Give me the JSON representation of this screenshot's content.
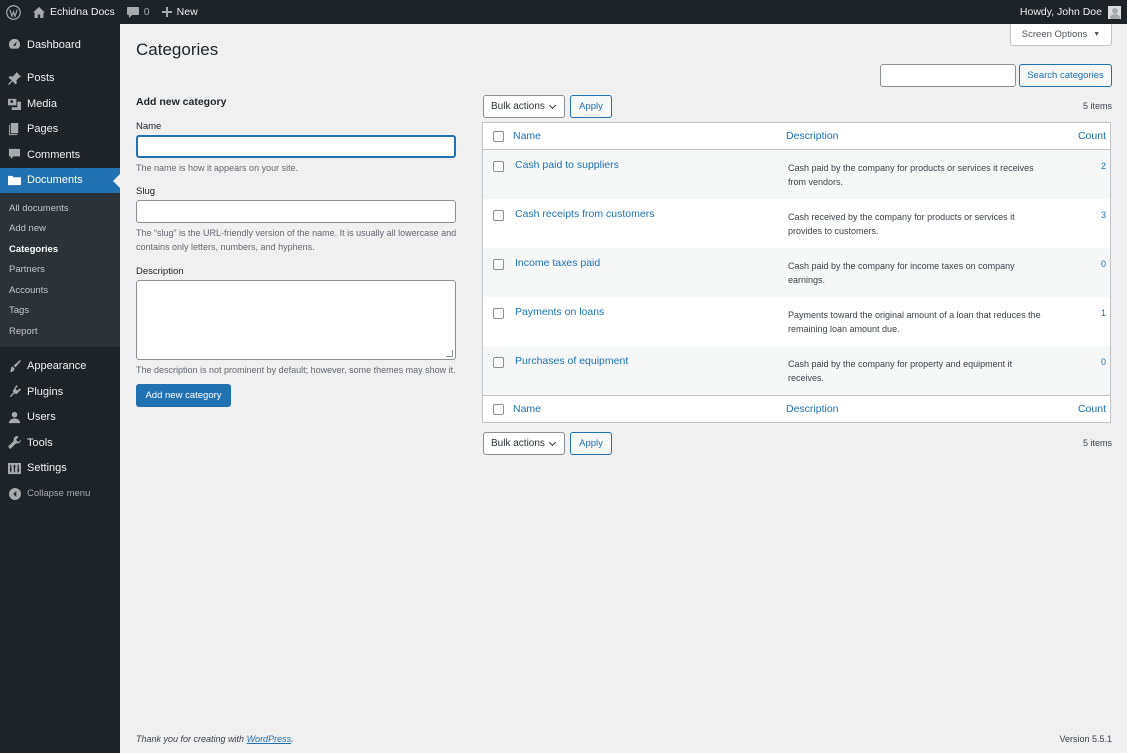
{
  "adminbar": {
    "site_name": "Echidna Docs",
    "comments_count": "0",
    "new_label": "New",
    "howdy": "Howdy, John Doe"
  },
  "sidebar": {
    "items": [
      {
        "label": "Dashboard",
        "icon": "dashboard-icon"
      },
      {
        "label": "Posts",
        "icon": "pin-icon"
      },
      {
        "label": "Media",
        "icon": "media-icon"
      },
      {
        "label": "Pages",
        "icon": "pages-icon"
      },
      {
        "label": "Comments",
        "icon": "comment-icon"
      },
      {
        "label": "Documents",
        "icon": "folder-icon",
        "current": true
      }
    ],
    "submenu": [
      "All documents",
      "Add new",
      "Categories",
      "Partners",
      "Accounts",
      "Tags",
      "Report"
    ],
    "submenu_current": "Categories",
    "items_bottom": [
      {
        "label": "Appearance",
        "icon": "brush-icon"
      },
      {
        "label": "Plugins",
        "icon": "plugin-icon"
      },
      {
        "label": "Users",
        "icon": "user-icon"
      },
      {
        "label": "Tools",
        "icon": "wrench-icon"
      },
      {
        "label": "Settings",
        "icon": "settings-icon"
      }
    ],
    "collapse": "Collapse menu"
  },
  "page": {
    "title": "Categories",
    "screen_options": "Screen Options",
    "search_button": "Search categories",
    "search_value": ""
  },
  "form": {
    "heading": "Add new category",
    "name_label": "Name",
    "name_value": "",
    "name_help": "The name is how it appears on your site.",
    "slug_label": "Slug",
    "slug_value": "",
    "slug_help": "The “slug” is the URL-friendly version of the name. It is usually all lowercase and contains only letters, numbers, and hyphens.",
    "desc_label": "Description",
    "desc_value": "",
    "desc_help": "The description is not prominent by default; however, some themes may show it.",
    "submit": "Add new category"
  },
  "table": {
    "bulk_actions": "Bulk actions",
    "apply": "Apply",
    "items_count": "5 items",
    "columns": {
      "name": "Name",
      "description": "Description",
      "count": "Count"
    },
    "rows": [
      {
        "name": "Cash paid to suppliers",
        "description": "Cash paid by the company for products or services it receives from vendors.",
        "count": "2"
      },
      {
        "name": "Cash receipts from customers",
        "description": "Cash received by the company for products or services it provides to customers.",
        "count": "3"
      },
      {
        "name": "Income taxes paid",
        "description": "Cash paid by the company for income taxes on company earnings.",
        "count": "0"
      },
      {
        "name": "Payments on loans",
        "description": "Payments toward the original amount of a loan that reduces the remaining loan amount due.",
        "count": "1"
      },
      {
        "name": "Purchases of equipment",
        "description": "Cash paid by the company for property and equipment it receives.",
        "count": "0"
      }
    ]
  },
  "footer": {
    "thanks_prefix": "Thank you for creating with ",
    "thanks_link": "WordPress",
    "thanks_suffix": ".",
    "version": "Version 5.5.1"
  },
  "colors": {
    "accent": "#2271b1",
    "sidebar": "#1d2327",
    "background": "#f0f0f1"
  }
}
